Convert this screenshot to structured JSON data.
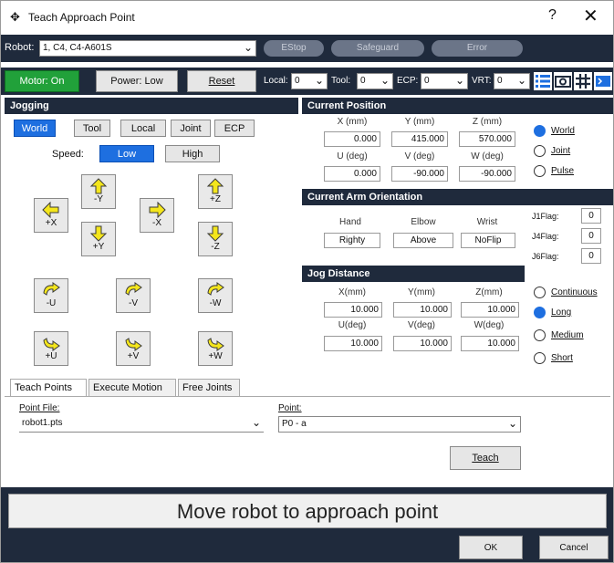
{
  "window": {
    "title": "Teach Approach Point",
    "help": "?",
    "close": "✕"
  },
  "row1": {
    "robot_label": "Robot:",
    "robot_value": "1, C4, C4-A601S",
    "estop": "EStop",
    "safeguard": "Safeguard",
    "error": "Error"
  },
  "row2": {
    "motor": "Motor: On",
    "power": "Power: Low",
    "reset": "Reset",
    "local_label": "Local:",
    "local_value": "0",
    "tool_label": "Tool:",
    "tool_value": "0",
    "ecp_label": "ECP:",
    "ecp_value": "0",
    "vrt_label": "VRT:",
    "vrt_value": "0"
  },
  "jogging": {
    "header": "Jogging",
    "modes": [
      "World",
      "Tool",
      "Local",
      "Joint",
      "ECP"
    ],
    "speed_label": "Speed:",
    "speed_low": "Low",
    "speed_high": "High",
    "buttons": {
      "px": "+X",
      "my": "-Y",
      "mx": "-X",
      "py": "+Y",
      "pz": "+Z",
      "mz": "-Z",
      "mu": "-U",
      "mv": "-V",
      "mw": "-W",
      "pu": "+U",
      "pv": "+V",
      "pw": "+W"
    }
  },
  "position": {
    "header": "Current Position",
    "h1": [
      "X (mm)",
      "Y (mm)",
      "Z (mm)"
    ],
    "v1": [
      "0.000",
      "415.000",
      "570.000"
    ],
    "h2": [
      "U (deg)",
      "V (deg)",
      "W (deg)"
    ],
    "v2": [
      "0.000",
      "-90.000",
      "-90.000"
    ],
    "radios": [
      "World",
      "Joint",
      "Pulse"
    ]
  },
  "orientation": {
    "header": "Current Arm Orientation",
    "h": [
      "Hand",
      "Elbow",
      "Wrist"
    ],
    "v": [
      "Righty",
      "Above",
      "NoFlip"
    ],
    "flags": [
      {
        "label": "J1Flag:",
        "value": "0"
      },
      {
        "label": "J4Flag:",
        "value": "0"
      },
      {
        "label": "J6Flag:",
        "value": "0"
      }
    ]
  },
  "jogdist": {
    "header": "Jog Distance",
    "h1": [
      "X(mm)",
      "Y(mm)",
      "Z(mm)"
    ],
    "v1": [
      "10.000",
      "10.000",
      "10.000"
    ],
    "h2": [
      "U(deg)",
      "V(deg)",
      "W(deg)"
    ],
    "v2": [
      "10.000",
      "10.000",
      "10.000"
    ],
    "radios": [
      "Continuous",
      "Long",
      "Medium",
      "Short"
    ]
  },
  "tabs": [
    "Teach Points",
    "Execute Motion",
    "Free Joints"
  ],
  "teach": {
    "file_label": "Point File:",
    "file_value": "robot1.pts",
    "point_label": "Point:",
    "point_value": "P0 - a",
    "teach_btn": "Teach"
  },
  "status": "Move robot to approach point",
  "footer": {
    "ok": "OK",
    "cancel": "Cancel"
  }
}
